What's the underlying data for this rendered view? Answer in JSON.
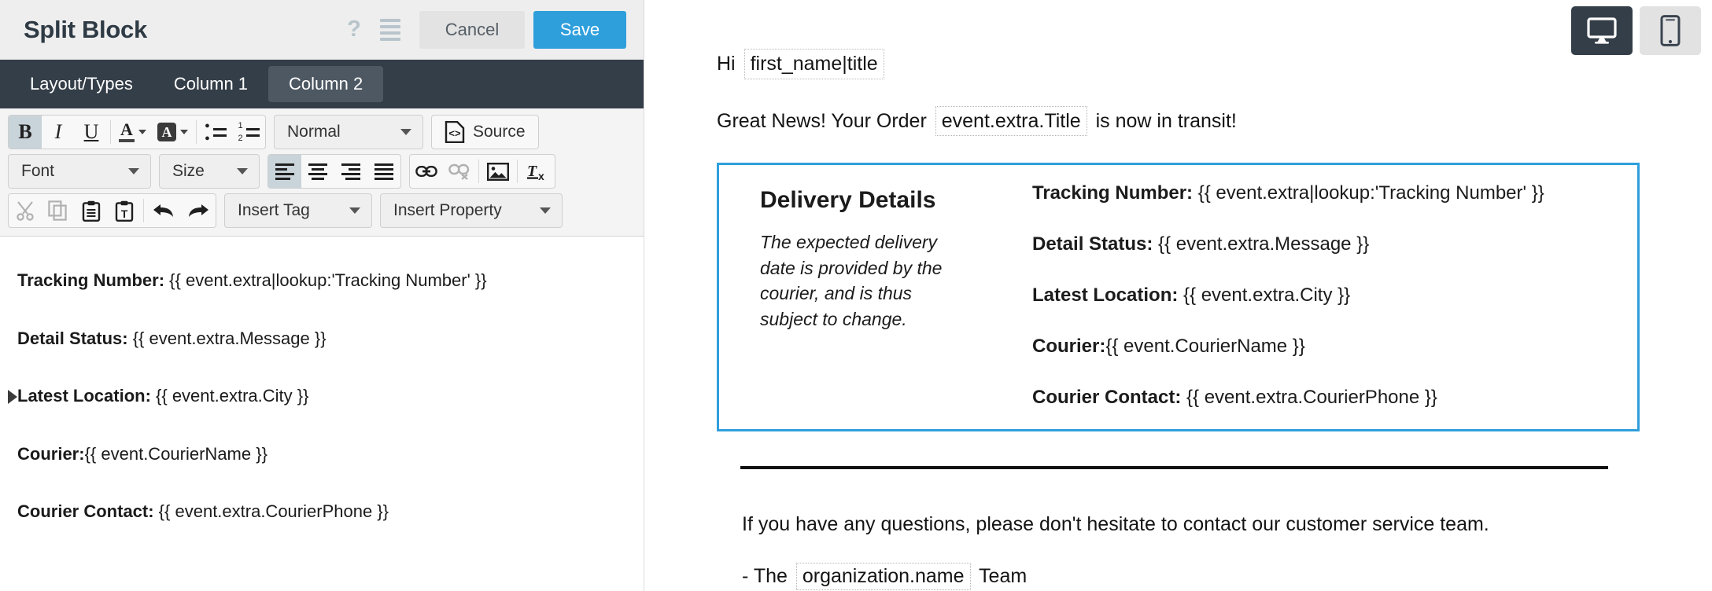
{
  "modal": {
    "title": "Split Block",
    "help_icon": "question-mark-icon",
    "menu_icon": "hamburger-icon",
    "cancel_label": "Cancel",
    "save_label": "Save",
    "save_color": "#2f9fdc"
  },
  "tabs": [
    {
      "label": "Layout/Types",
      "active": false
    },
    {
      "label": "Column 1",
      "active": false
    },
    {
      "label": "Column 2",
      "active": true
    }
  ],
  "toolbar": {
    "row1": {
      "bold": "B",
      "italic": "I",
      "underline": "U",
      "text_color": "A",
      "bg_color": "A",
      "bulleted_list": "bulleted-list-icon",
      "numbered_list": "numbered-list-icon",
      "format_label": "Normal",
      "source_label": "Source"
    },
    "row2": {
      "font_label": "Font",
      "size_label": "Size",
      "align_left": "align-left-icon",
      "align_center": "align-center-icon",
      "align_right": "align-right-icon",
      "align_justify": "align-justify-icon",
      "link": "link-icon",
      "unlink": "unlink-icon",
      "image": "image-icon",
      "remove_format": "remove-format-icon"
    },
    "row3": {
      "cut": "scissors-icon",
      "copy": "copy-icon",
      "paste": "paste-icon",
      "paste_text": "paste-as-text-icon",
      "undo": "undo-arrow-icon",
      "redo": "redo-arrow-icon",
      "insert_tag_label": "Insert Tag",
      "insert_property_label": "Insert Property"
    }
  },
  "editor_content": {
    "lines": [
      {
        "label": "Tracking Number:",
        "value": " {{ event.extra|lookup:'Tracking Number' }}",
        "marker": false
      },
      {
        "label": "Detail Status:",
        "value": " {{ event.extra.Message }}",
        "marker": false
      },
      {
        "label": "Latest Location:",
        "value": " {{ event.extra.City }}",
        "marker": true
      },
      {
        "label": "Courier:",
        "value": "{{ event.CourierName }}",
        "marker": false
      },
      {
        "label": "Courier Contact:",
        "value": " {{ event.extra.CourierPhone }}",
        "marker": false
      }
    ]
  },
  "preview": {
    "view_desktop_icon": "desktop-monitor-icon",
    "view_mobile_icon": "mobile-phone-icon",
    "greeting_prefix": "Hi ",
    "greeting_tag": "first_name|title",
    "order_prefix": "Great News! Your Order ",
    "order_tag": "event.extra.Title",
    "order_suffix": " is now in transit!",
    "details": {
      "heading": "Delivery Details",
      "note": "The expected delivery date is provided by the courier, and is thus subject to change.",
      "border_color": "#2f9fdc",
      "lines": [
        {
          "label": "Tracking Number:",
          "value": " {{ event.extra|lookup:'Tracking Number' }}"
        },
        {
          "label": "Detail Status:",
          "value": " {{ event.extra.Message }}"
        },
        {
          "label": "Latest Location:",
          "value": " {{ event.extra.City }}"
        },
        {
          "label": "Courier:",
          "value": "{{ event.CourierName }}"
        },
        {
          "label": "Courier Contact:",
          "value": " {{ event.extra.CourierPhone }}"
        }
      ]
    },
    "footer": {
      "question_line": "If you have any questions, please don't hesitate to contact our customer service team.",
      "signoff_prefix": "- The ",
      "signoff_tag": "organization.name",
      "signoff_suffix": " Team"
    }
  }
}
